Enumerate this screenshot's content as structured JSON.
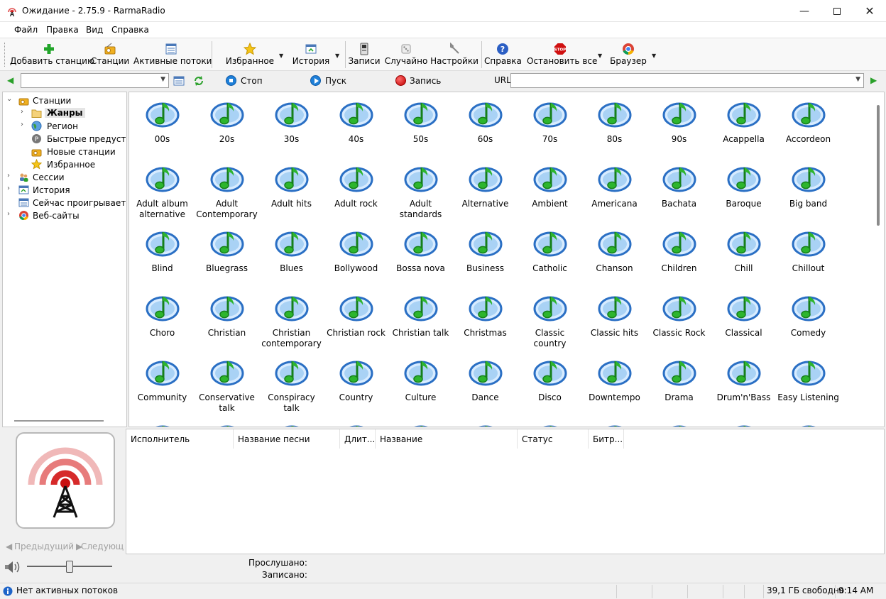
{
  "window": {
    "title": "Ожидание - 2.75.9 - RarmaRadio"
  },
  "menu": [
    "Файл",
    "Правка",
    "Вид",
    "Справка"
  ],
  "toolbar": {
    "add_station": "Добавить станцию",
    "stations": "Станции",
    "active_streams": "Активные потоки",
    "favorites": "Избранное",
    "history": "История",
    "recordings": "Записи",
    "random": "Случайно",
    "settings": "Настройки",
    "help": "Справка",
    "stop_all": "Остановить все",
    "browser": "Браузер"
  },
  "address": {
    "stop": "Стоп",
    "play": "Пуск",
    "record": "Запись",
    "url_label": "URL",
    "station_value": "",
    "url_value": ""
  },
  "tree": {
    "root": "Станции",
    "genres": "Жанры",
    "region": "Регион",
    "presets": "Быстрые предустановки",
    "new_stations": "Новые станции",
    "favorites": "Избранное",
    "sessions": "Сессии",
    "history": "История",
    "now_playing": "Сейчас проигрывается",
    "websites": "Веб-сайты"
  },
  "genres": [
    [
      "00s",
      "20s",
      "30s",
      "40s",
      "50s",
      "60s",
      "70s",
      "80s",
      "90s",
      "Acappella",
      "Accordeon"
    ],
    [
      "Adult album alternative",
      "Adult Contemporary",
      "Adult hits",
      "Adult rock",
      "Adult standards",
      "Alternative",
      "Ambient",
      "Americana",
      "Bachata",
      "Baroque",
      "Big band"
    ],
    [
      "Blind",
      "Bluegrass",
      "Blues",
      "Bollywood",
      "Bossa nova",
      "Business",
      "Catholic",
      "Chanson",
      "Children",
      "Chill",
      "Chillout"
    ],
    [
      "Choro",
      "Christian",
      "Christian contemporary",
      "Christian rock",
      "Christian talk",
      "Christmas",
      "Classic country",
      "Classic hits",
      "Classic Rock",
      "Classical",
      "Comedy"
    ],
    [
      "Community",
      "Conservative talk",
      "Conspiracy talk",
      "Country",
      "Culture",
      "Dance",
      "Disco",
      "Downtempo",
      "Drama",
      "Drum'n'Bass",
      "Easy Listening"
    ]
  ],
  "player": {
    "prev": "Предыдущий",
    "next": "Следующий",
    "listened_label": "Прослушано:",
    "recorded_label": "Записано:"
  },
  "playlist_columns": [
    "Исполнитель",
    "Название песни",
    "Длит...",
    "Название",
    "Статус",
    "Битр..."
  ],
  "status": {
    "message": "Нет активных потоков",
    "free_space": "39,1 ГБ свободно",
    "time": "9:14 AM"
  },
  "colors": {
    "accent": "#0078d7",
    "note_green": "#2db52d",
    "bubble_blue": "#3a7fd0",
    "record_red": "#d01010"
  }
}
